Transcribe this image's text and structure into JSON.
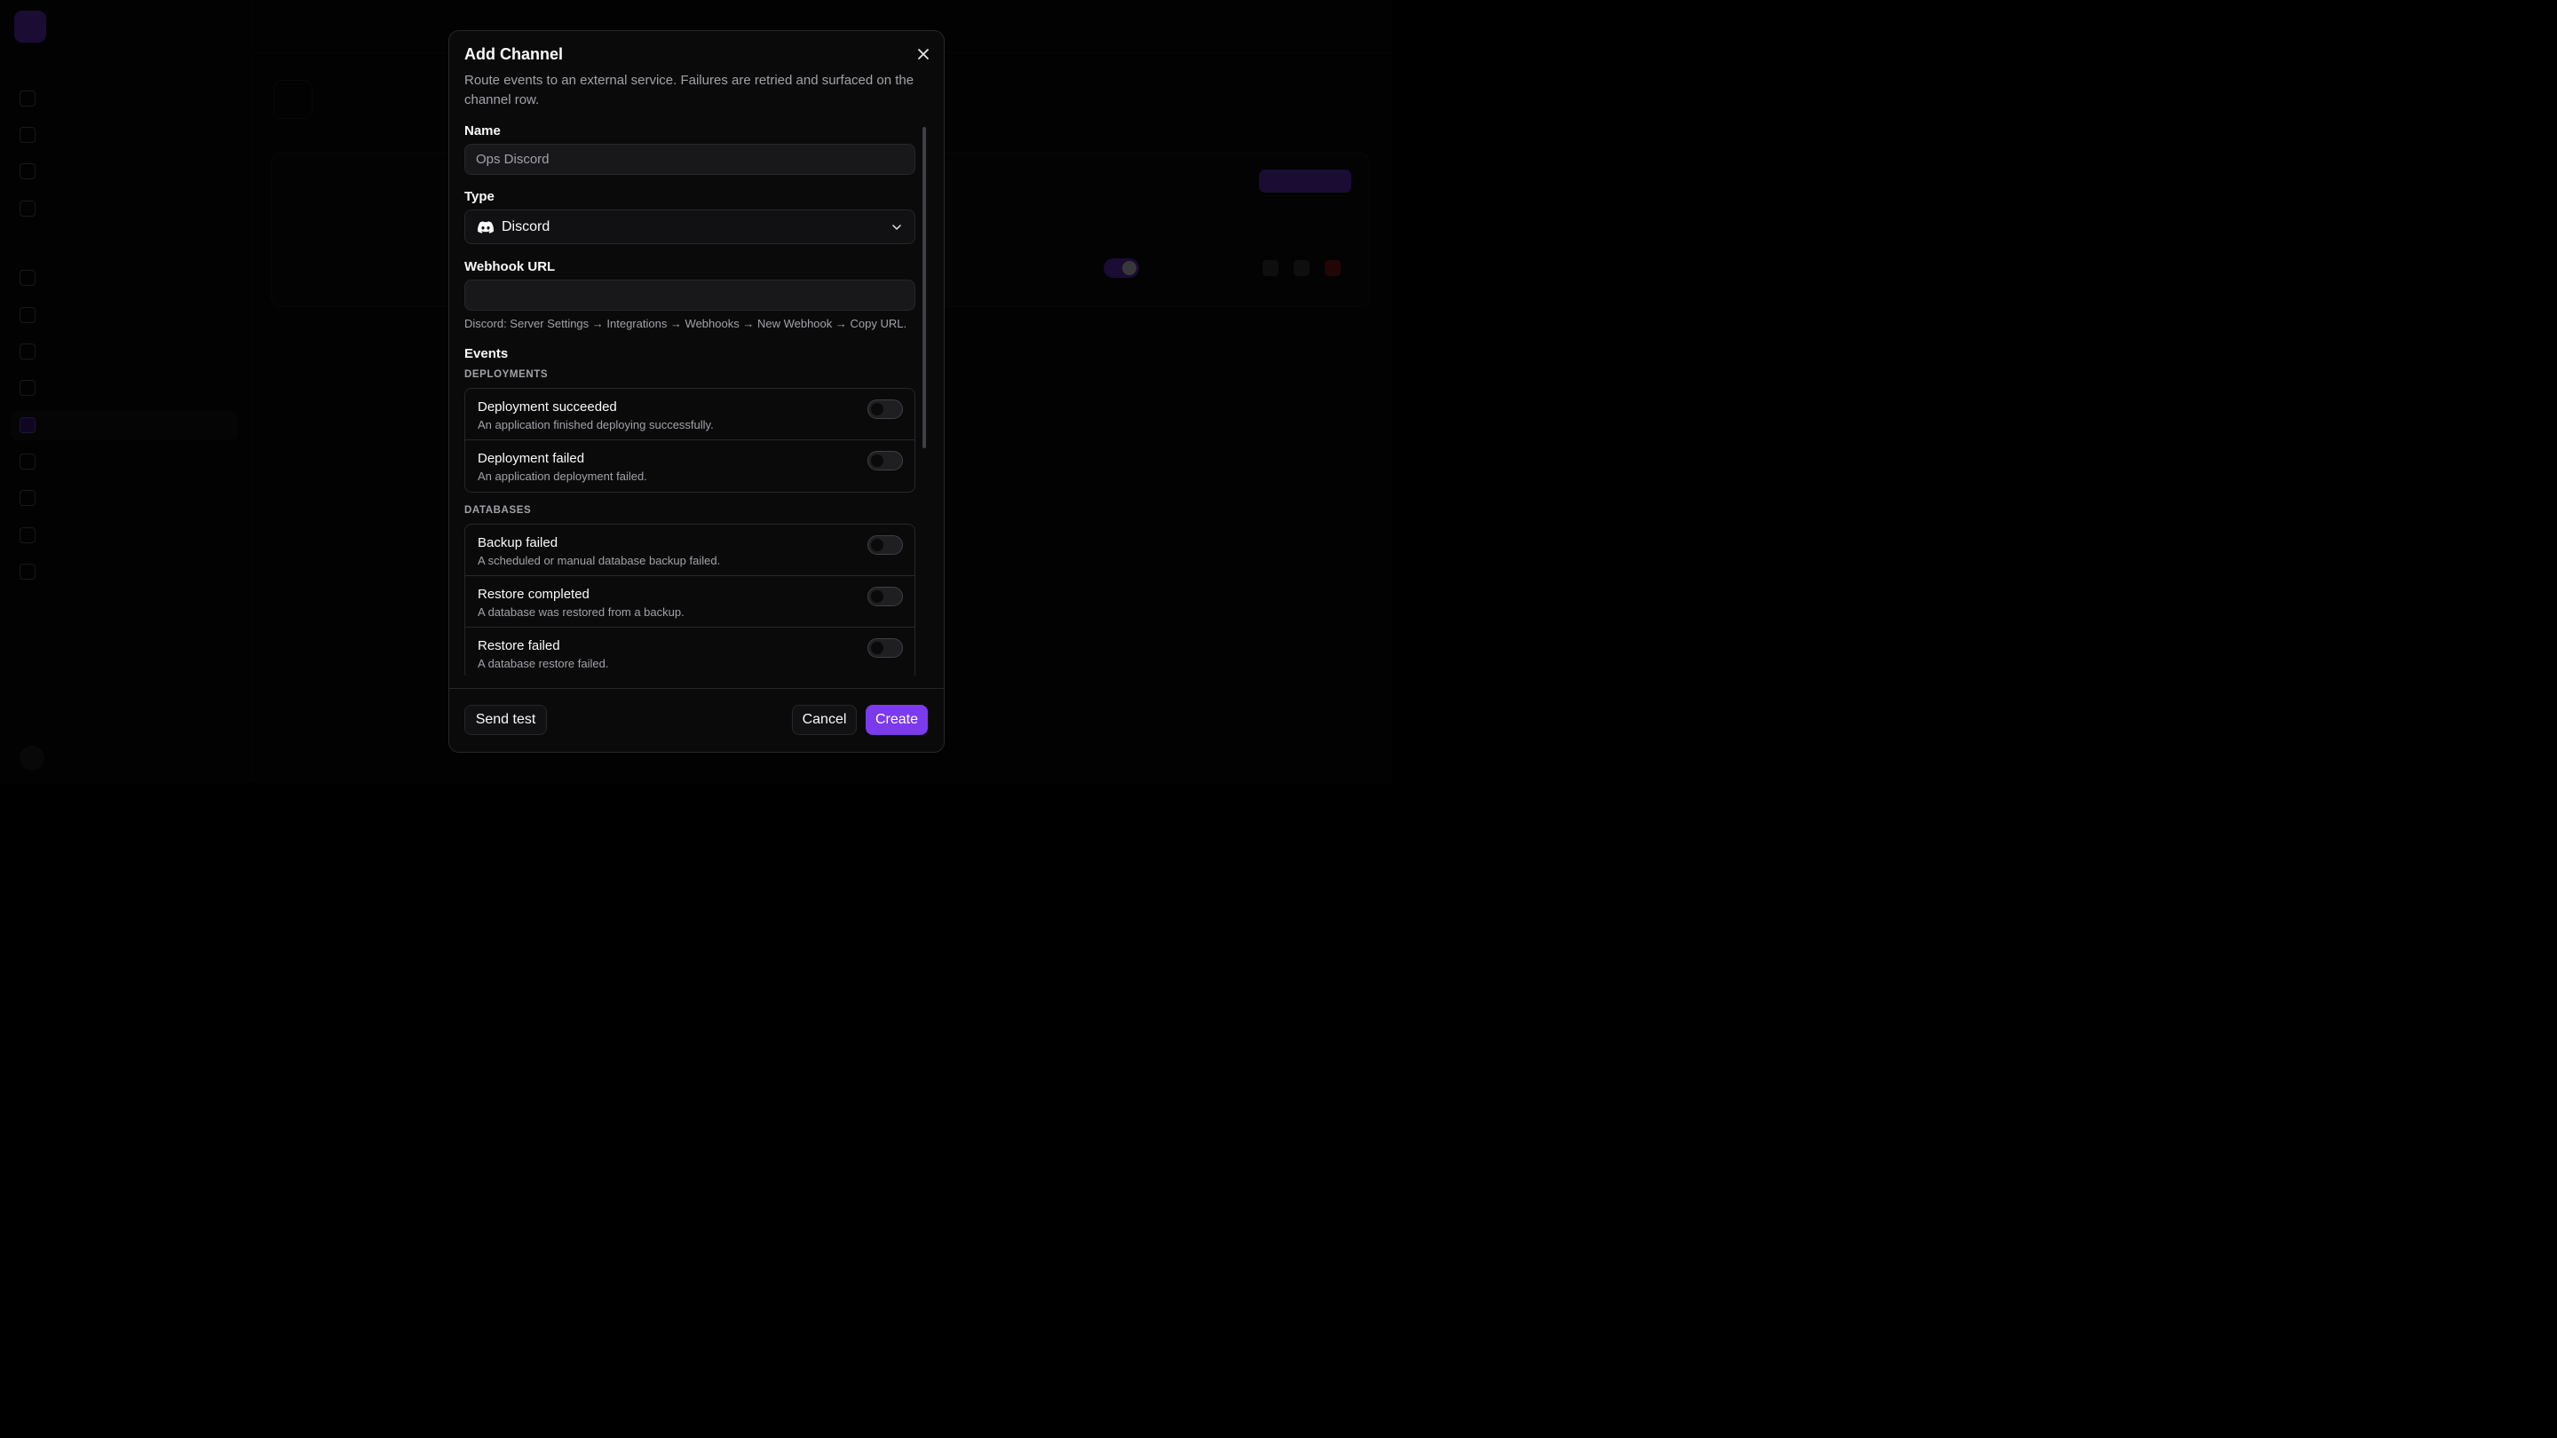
{
  "modal": {
    "title": "Add Channel",
    "description": "Route events to an external service. Failures are retried and surfaced on the channel row.",
    "name_label": "Name",
    "name_placeholder": "Ops Discord",
    "type_label": "Type",
    "type_value": "Discord",
    "webhook_label": "Webhook URL",
    "webhook_value": "",
    "webhook_hint": "Discord: Server Settings → Integrations → Webhooks → New Webhook → Copy URL.",
    "events_label": "Events",
    "groups": [
      {
        "caption": "DEPLOYMENTS",
        "events": [
          {
            "title": "Deployment succeeded",
            "desc": "An application finished deploying successfully.",
            "enabled": false
          },
          {
            "title": "Deployment failed",
            "desc": "An application deployment failed.",
            "enabled": false
          }
        ]
      },
      {
        "caption": "DATABASES",
        "events": [
          {
            "title": "Backup failed",
            "desc": "A scheduled or manual database backup failed.",
            "enabled": false
          },
          {
            "title": "Restore completed",
            "desc": "A database was restored from a backup.",
            "enabled": false
          },
          {
            "title": "Restore failed",
            "desc": "A database restore failed.",
            "enabled": false
          }
        ]
      }
    ],
    "footer": {
      "send_test": "Send test",
      "cancel": "Cancel",
      "create": "Create"
    }
  },
  "colors": {
    "accent": "#7c3aed",
    "background": "#0a0a0a",
    "border": "#27272a",
    "muted_text": "#a1a1aa"
  },
  "icons": {
    "close": "close-icon",
    "type": "discord-icon",
    "dropdown": "chevron-down-icon"
  }
}
